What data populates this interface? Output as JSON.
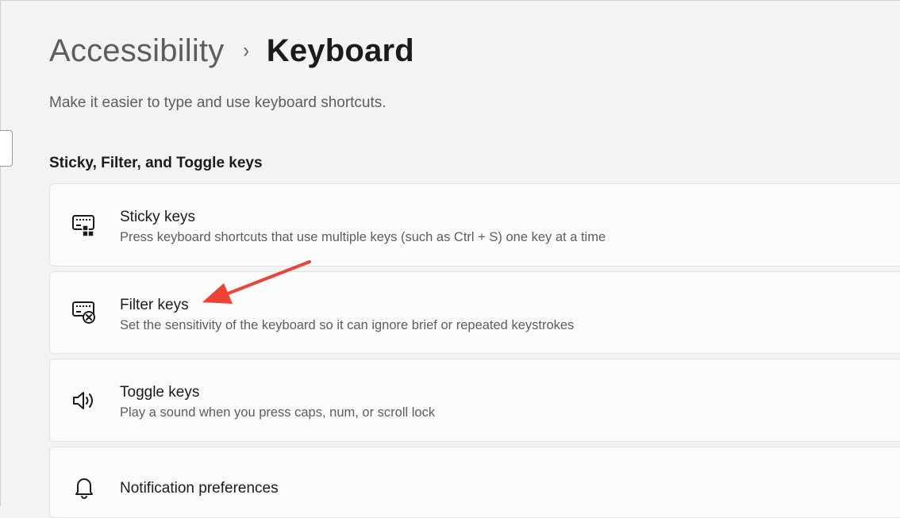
{
  "header": {
    "breadcrumb_parent": "Accessibility",
    "breadcrumb_separator": "›",
    "breadcrumb_current": "Keyboard",
    "subtitle": "Make it easier to type and use keyboard shortcuts."
  },
  "section": {
    "title": "Sticky, Filter, and Toggle keys"
  },
  "items": [
    {
      "icon": "sticky-keys-icon",
      "title": "Sticky keys",
      "description": "Press keyboard shortcuts that use multiple keys (such as Ctrl + S) one key at a time"
    },
    {
      "icon": "filter-keys-icon",
      "title": "Filter keys",
      "description": "Set the sensitivity of the keyboard so it can ignore brief or repeated keystrokes"
    },
    {
      "icon": "speaker-icon",
      "title": "Toggle keys",
      "description": "Play a sound when you press caps, num, or scroll lock"
    },
    {
      "icon": "bell-icon",
      "title": "Notification preferences",
      "description": ""
    }
  ],
  "annotation": {
    "arrow_color": "#ef4136",
    "points_to": "Filter keys"
  }
}
